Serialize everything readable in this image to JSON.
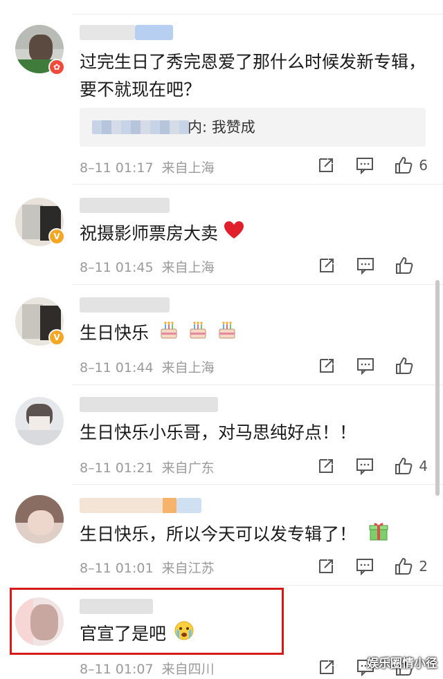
{
  "comments": [
    {
      "body": "过完生日了秀完恩爱了那什么时候发新专辑，要不就现在吧？",
      "reply": {
        "text": "内: 我赞成"
      },
      "time": "8–11 01:17",
      "location": "来自上海",
      "likes": "6",
      "badge": {
        "type": "red",
        "glyph": "✿"
      }
    },
    {
      "body": "祝摄影师票房大卖",
      "emoji": "red-heart-icon",
      "time": "8–11 01:45",
      "location": "来自上海",
      "likes": "",
      "badge": {
        "type": "gold",
        "glyph": "V"
      }
    },
    {
      "body": "生日快乐",
      "emoji": "birthday-cake-icon",
      "time": "8–11 01:44",
      "location": "来自上海",
      "likes": "",
      "badge": {
        "type": "gold",
        "glyph": "V"
      }
    },
    {
      "body": "生日快乐小乐哥，对马思纯好点！！",
      "time": "8–11 01:21",
      "location": "来自广东",
      "likes": "4"
    },
    {
      "body": "生日快乐，所以今天可以发专辑了！",
      "emoji": "gift-icon",
      "time": "8–11 01:01",
      "location": "来自江苏",
      "likes": "2"
    },
    {
      "body": "官宣了是吧",
      "emoji": "crying-face-icon",
      "time": "8–11 01:07",
      "location": "来自四川",
      "likes": ""
    }
  ],
  "watermark": "娱乐圈情小径",
  "colors": {
    "highlight": "#d61a1a",
    "meta": "#9a9a9a",
    "heart": "#e0202a"
  }
}
